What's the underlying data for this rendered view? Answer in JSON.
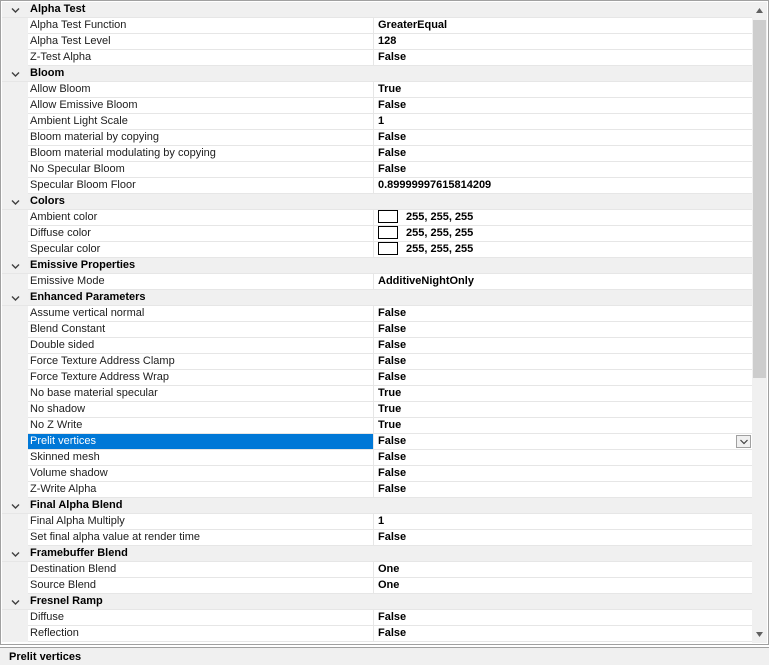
{
  "categories": [
    {
      "title": "Alpha Test",
      "props": [
        {
          "name": "Alpha Test Function",
          "value": "GreaterEqual"
        },
        {
          "name": "Alpha Test Level",
          "value": "128"
        },
        {
          "name": "Z-Test Alpha",
          "value": "False"
        }
      ]
    },
    {
      "title": "Bloom",
      "props": [
        {
          "name": "Allow Bloom",
          "value": "True"
        },
        {
          "name": "Allow Emissive Bloom",
          "value": "False"
        },
        {
          "name": "Ambient Light Scale",
          "value": "1"
        },
        {
          "name": "Bloom material by copying",
          "value": "False"
        },
        {
          "name": "Bloom material modulating by copying",
          "value": "False"
        },
        {
          "name": "No Specular Bloom",
          "value": "False"
        },
        {
          "name": "Specular Bloom Floor",
          "value": "0.89999997615814209"
        }
      ]
    },
    {
      "title": "Colors",
      "props": [
        {
          "name": "Ambient color",
          "value": "255, 255, 255",
          "swatch": "#ffffff"
        },
        {
          "name": "Diffuse color",
          "value": "255, 255, 255",
          "swatch": "#ffffff"
        },
        {
          "name": "Specular color",
          "value": "255, 255, 255",
          "swatch": "#ffffff"
        }
      ]
    },
    {
      "title": "Emissive Properties",
      "props": [
        {
          "name": "Emissive Mode",
          "value": "AdditiveNightOnly"
        }
      ]
    },
    {
      "title": "Enhanced Parameters",
      "props": [
        {
          "name": "Assume vertical normal",
          "value": "False"
        },
        {
          "name": "Blend Constant",
          "value": "False"
        },
        {
          "name": "Double sided",
          "value": "False"
        },
        {
          "name": "Force Texture Address Clamp",
          "value": "False"
        },
        {
          "name": "Force Texture Address Wrap",
          "value": "False"
        },
        {
          "name": "No base material specular",
          "value": "True"
        },
        {
          "name": "No shadow",
          "value": "True"
        },
        {
          "name": "No Z Write",
          "value": "True"
        },
        {
          "name": "Prelit vertices",
          "value": "False",
          "selected": true
        },
        {
          "name": "Skinned mesh",
          "value": "False"
        },
        {
          "name": "Volume shadow",
          "value": "False"
        },
        {
          "name": "Z-Write Alpha",
          "value": "False"
        }
      ]
    },
    {
      "title": "Final Alpha Blend",
      "props": [
        {
          "name": "Final Alpha Multiply",
          "value": "1"
        },
        {
          "name": "Set final alpha value at render time",
          "value": "False"
        }
      ]
    },
    {
      "title": "Framebuffer Blend",
      "props": [
        {
          "name": "Destination Blend",
          "value": "One"
        },
        {
          "name": "Source Blend",
          "value": "One"
        }
      ]
    },
    {
      "title": "Fresnel Ramp",
      "props": [
        {
          "name": "Diffuse",
          "value": "False"
        },
        {
          "name": "Reflection",
          "value": "False"
        }
      ]
    }
  ],
  "status_text": "Prelit vertices",
  "colors": {
    "selection": "#0078d7",
    "category_bg": "#f0f0f0"
  },
  "icons": {
    "category_toggle": "chevron-down-icon",
    "dropdown": "dropdown-arrow-icon"
  }
}
